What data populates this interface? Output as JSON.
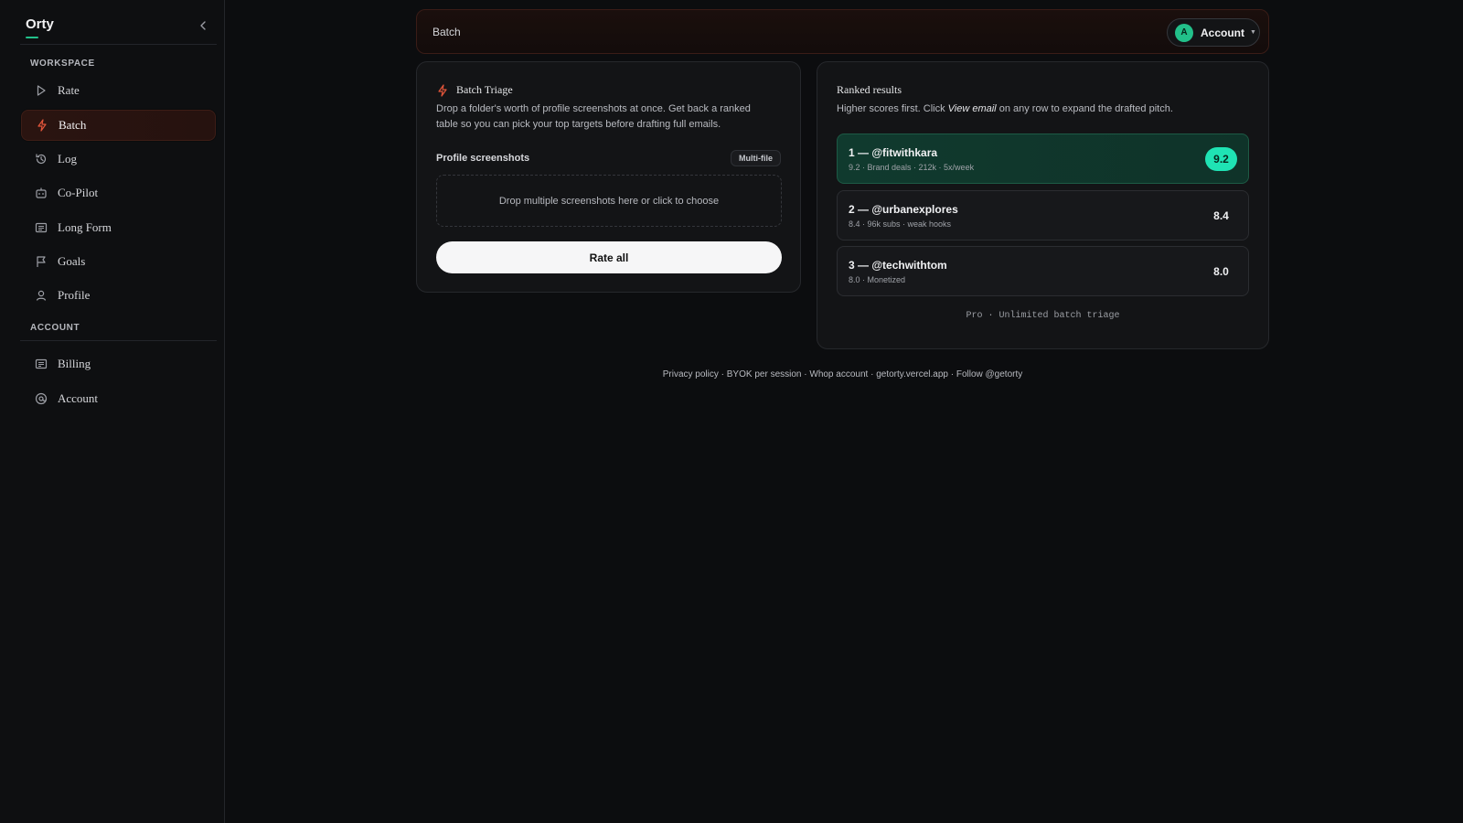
{
  "app": {
    "name": "Orty"
  },
  "sidebar": {
    "sections": [
      {
        "label": "WORKSPACE"
      },
      {
        "label": "ACCOUNT"
      }
    ],
    "items": [
      {
        "label": "Rate",
        "icon": "play-icon"
      },
      {
        "label": "Batch",
        "icon": "lightning-icon",
        "active": true
      },
      {
        "label": "Log",
        "icon": "history-icon"
      },
      {
        "label": "Co-Pilot",
        "icon": "bot-icon"
      },
      {
        "label": "Long Form",
        "icon": "document-icon"
      },
      {
        "label": "Goals",
        "icon": "flag-icon"
      },
      {
        "label": "Profile",
        "icon": "user-icon"
      },
      {
        "label": "Billing",
        "icon": "receipt-icon"
      },
      {
        "label": "Account",
        "icon": "at-icon"
      }
    ]
  },
  "header": {
    "title": "Batch",
    "account": {
      "avatar_letter": "A",
      "label": "Account"
    }
  },
  "triage": {
    "title": "Batch Triage",
    "description": "Drop a folder's worth of profile screenshots at once. Get back a ranked table so you can pick your top targets before drafting full emails.",
    "field_label": "Profile screenshots",
    "badge": "Multi-file",
    "dropzone_text": "Drop multiple screenshots here or click to choose",
    "button": "Rate all"
  },
  "results": {
    "title": "Ranked results",
    "desc_before": "Higher scores first. Click ",
    "desc_em": "View email",
    "desc_after": " on any row to expand the drafted pitch.",
    "rows": [
      {
        "title": "1 — @fitwithkara",
        "subtitle": "9.2 · Brand deals · 212k · 5x/week",
        "score": "9.2"
      },
      {
        "title": "2 — @urbanexplores",
        "subtitle": "8.4 · 96k subs · weak hooks",
        "score": "8.4"
      },
      {
        "title": "3 — @techwithtom",
        "subtitle": "8.0 · Monetized",
        "score": "8.0"
      }
    ],
    "plan_note": "Pro · Unlimited batch triage"
  },
  "footer": {
    "links": [
      "Privacy policy",
      "BYOK per session",
      "Whop account",
      "getorty.vercel.app",
      "Follow @getorty"
    ],
    "separator": " · "
  },
  "colors": {
    "accent_green": "#22c08a",
    "score_pill": "#1fe3b4",
    "accent_red": "#e2553a",
    "background": "#0c0d0f"
  }
}
